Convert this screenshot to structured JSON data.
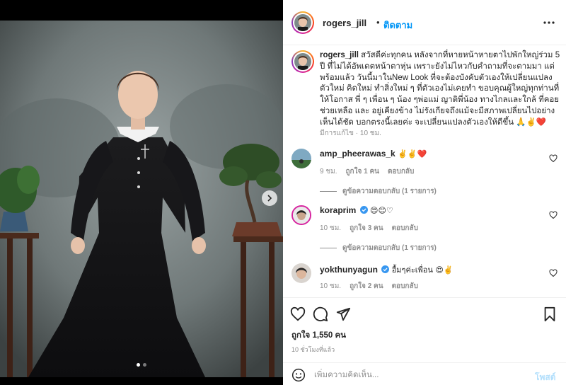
{
  "post": {
    "username": "rogers_jill",
    "follow_label": "ติดตาม",
    "header_separator": "•",
    "caption_username": "rogers_jill",
    "caption_text": "สวัสดีค่ะทุกคน หลังจากที่หายหน้าหายตาไปพักใหญ่ร่วม 5 ปี ที่ไม่ได้อัพเดตหน้าตาหุ่น เพราะยังไม่ไหวกับคำถามที่จะตามมา แต่พร้อมแล้ว วันนี้มาในNew Look ที่จะต้องบังคับตัวเองให้เปลี่ยนแปลงตัวใหม่ คิดใหม่ ทำสิ่งใหม่ ๆ ที่ตัวเองไม่เคยทำ ขอบคุณผู้ใหญ่ทุกท่านที่ให้โอกาส พี่ ๆ เพื่อน ๆ น้อง ๆพ่อแม่ ญาติพี่น้อง ทางไกลและใกล้ ที่คอยช่วยเหลือ และ อยู่เคียงข้าง ไม่รังเกียจถึงแม้จะมีสภาพเปลี่ยนไปอย่างเห็นได้ชัด บอกตรงนี้เลยค่ะ จะเปลี่ยนแปลงตัวเองให้ดีขึ้น 🙏✌️❤️",
    "caption_meta": "มีการแก้ไข · 10 ชม.",
    "likes": "ถูกใจ 1,550 คน",
    "time_ago": "10 ชั่วโมงที่แล้ว"
  },
  "comments": [
    {
      "username": "amp_pheerawas_k",
      "text": "✌️✌️❤️",
      "verified": false,
      "time": "9 ชม.",
      "likes": "ถูกใจ 1 คน",
      "reply_label": "ตอบกลับ",
      "view_replies": "ดูข้อความตอบกลับ (1 รายการ)"
    },
    {
      "username": "koraprim",
      "text": "😍😊♡",
      "verified": true,
      "time": "10 ชม.",
      "likes": "ถูกใจ 3 คน",
      "reply_label": "ตอบกลับ",
      "view_replies": "ดูข้อความตอบกลับ (1 รายการ)"
    },
    {
      "username": "yokthunyagun",
      "text": "อื้มๆค่ะเพื่อน 😍✌️",
      "verified": true,
      "time": "10 ชม.",
      "likes": "ถูกใจ 2 คน",
      "reply_label": "ตอบกลับ",
      "view_replies": ""
    }
  ],
  "composer": {
    "placeholder": "เพิ่มความคิดเห็น...",
    "post_label": "โพสต์"
  },
  "carousel": {
    "current": 1,
    "total": 2
  },
  "colors": {
    "link_blue": "#0095f6",
    "verified_blue": "#3897f0",
    "muted": "#8e8e8e",
    "post_button_disabled": "#b2dffc"
  },
  "icons": [
    "more-icon",
    "heart-icon",
    "comment-icon",
    "share-icon",
    "bookmark-icon",
    "emoji-icon",
    "next-arrow-icon",
    "verified-icon"
  ]
}
